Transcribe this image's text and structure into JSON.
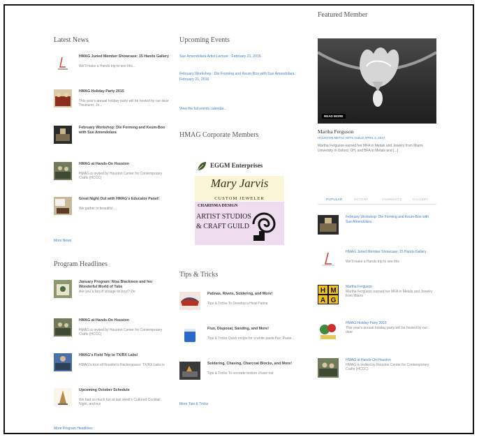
{
  "latest_news": {
    "heading": "Latest News",
    "items": [
      {
        "title": "HMAG Juried Member Showcase: 15 Hands Gallery",
        "excerpt": "We’ll make a Hands trip to see this..."
      },
      {
        "title": "HMAG Holiday Party 2015",
        "excerpt": "This year's annual holiday party will be hosted by our dear Treasurer, Jo..."
      },
      {
        "title": "February Workshop: Die Forming and Keum-Boo with Sue Amendolara",
        "excerpt": ""
      },
      {
        "title": "HMAG at Hands-On Houston",
        "excerpt": "HMAG is invited by Houston Center for Contemporary Crafts (HCCC)"
      },
      {
        "title": "Great Night Out with HMAG's Educator Panel!",
        "excerpt": "We gather in beautiful ..."
      }
    ],
    "more_link": "More News"
  },
  "program_headlines": {
    "heading": "Program Headlines",
    "items": [
      {
        "title": "January Program: Nisa Blackmon and her Wonderful World of Tabs",
        "excerpt": "Are you a fan of vintage tin toys? Do"
      },
      {
        "title": "HMAG at Hands-On Houston",
        "excerpt": "HMAG is invited by Houston Center for Contemporary Crafts (HCCC)"
      },
      {
        "title": "HMAG's Field Trip to TX/RX Labs!",
        "excerpt": "HMAG's tour of Houston's Hackerspace: TX/RX Labs is"
      },
      {
        "title": "Upcoming October Schedule",
        "excerpt": "We had so much fun at last week's Cultured Cocktail Night, and our"
      }
    ],
    "more_link": "More Program Headlines"
  },
  "upcoming_events": {
    "heading": "Upcoming Events",
    "items": [
      {
        "text": "Sue Amendolara Artist Lecture : February 21, 2016"
      },
      {
        "text": "February Workshop : Die Forming and Keum-Boo with Sue Amendolara : February 21, 2016"
      }
    ],
    "more_link": "View the full events calendar..."
  },
  "corporate_members": {
    "heading": "HMAG Corporate Members",
    "logos": {
      "eggm": "EGGM Enterprises",
      "mj_name": "Mary Jarvis",
      "mj_sub": "CUSTOM JEWELER",
      "cd_top": "CHARISMA DESIGN",
      "cd_line1": "ARTIST STUDIOS",
      "cd_line2": "& CRAFT GUILD"
    }
  },
  "tips": {
    "heading": "Tips & Tricks",
    "items": [
      {
        "title": "Patinas, Rivets, Soldering, and More!",
        "excerpt": "Tips & Tricks To Develop a Heat Patina"
      },
      {
        "title": "Flux, Disposal, Sanding, and More!",
        "excerpt": "Tips & Tricks Quick recipe for a white paste flux. Paste..."
      },
      {
        "title": "Soldering, Chasing, Charcoal Blocks, and More!",
        "excerpt": "Tips & Tricks To recreate texture chase out"
      }
    ],
    "more_link": "More Tips & Tricks"
  },
  "featured": {
    "heading": "Featured Member",
    "read_more": "READ MORE",
    "name": "Martha Ferguson",
    "meta": "HOUSTON METAL ARTS GUILD  APRIL 2, 2017",
    "text": "Martha Ferguson earned her MFA in Metals and Jewelry from Miami University in Oxford, OH, and BFA in Metals and [...]"
  },
  "sidebar": {
    "tabs": [
      "POPULAR",
      "RECENT",
      "COMMENTS",
      "GALLERY"
    ],
    "items": [
      {
        "title": "February Workshop: Die Forming and Keum-Boo with Sue Amendolara",
        "excerpt": ""
      },
      {
        "title": "HMAG Juried Member Showcase: 15 Hands Gallery",
        "excerpt": "We’ll make a Hands trip to see this"
      },
      {
        "title": "Martha Ferguson",
        "excerpt": "Martha Ferguson earned her MFA in Metals and Jewelry from Miami"
      },
      {
        "title": "HMAG Holiday Party 2015",
        "excerpt": "This year's annual holiday party will be hosted by our dear"
      },
      {
        "title": "HMAG at Hands-On Houston",
        "excerpt": "HMAG is invited by Houston Center for Contemporary Crafts (HCCC)"
      }
    ]
  },
  "colors": {
    "link": "#3d7fc7",
    "text": "#333333",
    "muted": "#888888"
  }
}
